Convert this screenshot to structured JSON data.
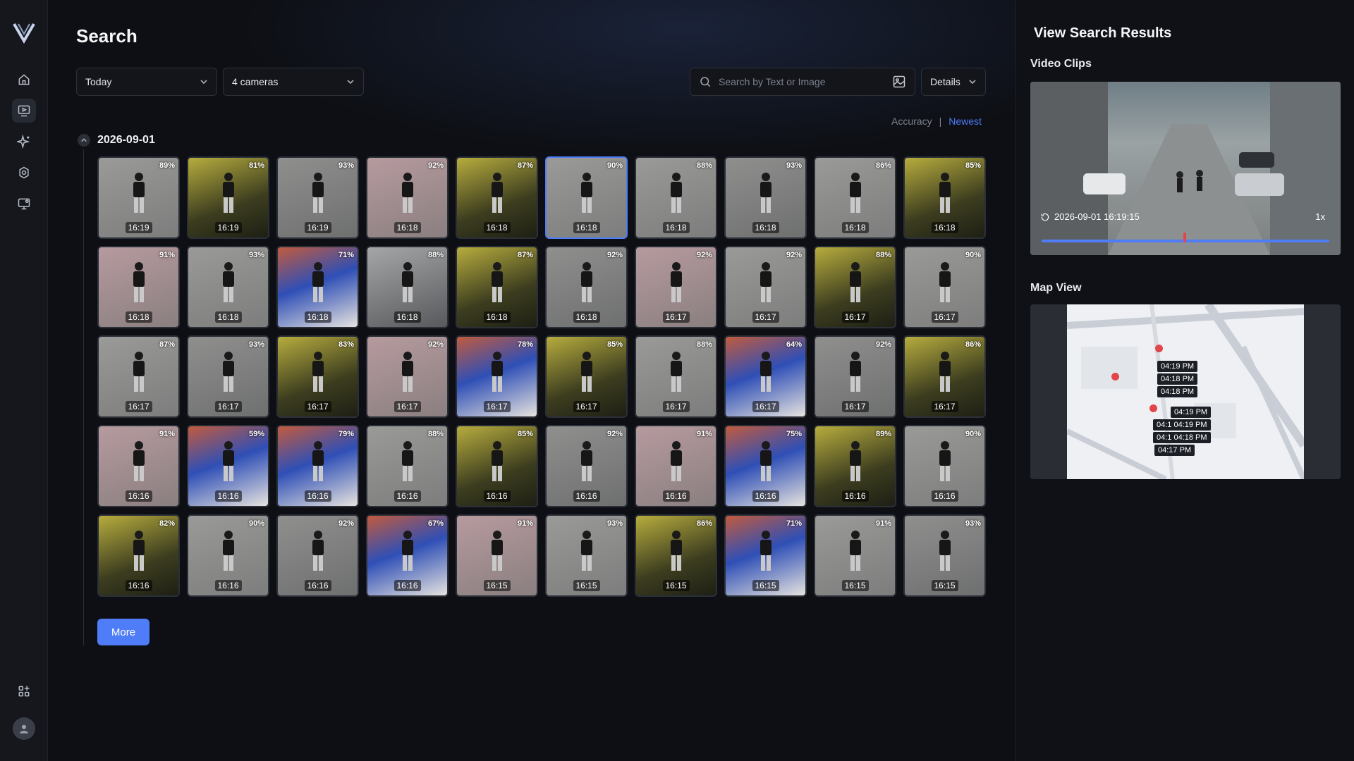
{
  "app": {
    "logo": "V"
  },
  "sidebar": {
    "items": [
      {
        "icon": "home-icon"
      },
      {
        "icon": "video-search-icon",
        "active": true
      },
      {
        "icon": "sparkle-icon"
      },
      {
        "icon": "settings-icon"
      },
      {
        "icon": "monitor-icon"
      },
      {
        "icon": "apps-icon"
      }
    ]
  },
  "header": {
    "title": "Search",
    "date_filter": "Today",
    "camera_filter": "4 cameras",
    "search_placeholder": "Search by Text or Image",
    "details_label": "Details"
  },
  "sort": {
    "accuracy": "Accuracy",
    "separator": "|",
    "newest": "Newest"
  },
  "results": {
    "date": "2026-09-01",
    "more_label": "More",
    "items": [
      {
        "pct": "89%",
        "time": "16:19",
        "scene": "street"
      },
      {
        "pct": "81%",
        "time": "16:19",
        "scene": "yellow"
      },
      {
        "pct": "93%",
        "time": "16:19",
        "scene": "road"
      },
      {
        "pct": "92%",
        "time": "16:18",
        "scene": "pink"
      },
      {
        "pct": "87%",
        "time": "16:18",
        "scene": "yellow"
      },
      {
        "pct": "90%",
        "time": "16:18",
        "scene": "street",
        "selected": true
      },
      {
        "pct": "88%",
        "time": "16:18",
        "scene": "street"
      },
      {
        "pct": "93%",
        "time": "16:18",
        "scene": "road"
      },
      {
        "pct": "86%",
        "time": "16:18",
        "scene": "street"
      },
      {
        "pct": "85%",
        "time": "16:18",
        "scene": "yellow"
      },
      {
        "pct": "91%",
        "time": "16:18",
        "scene": "pink"
      },
      {
        "pct": "93%",
        "time": "16:18",
        "scene": "street"
      },
      {
        "pct": "71%",
        "time": "16:18",
        "scene": "blue"
      },
      {
        "pct": "88%",
        "time": "16:18",
        "scene": "car"
      },
      {
        "pct": "87%",
        "time": "16:18",
        "scene": "yellow"
      },
      {
        "pct": "92%",
        "time": "16:18",
        "scene": "road"
      },
      {
        "pct": "92%",
        "time": "16:17",
        "scene": "pink"
      },
      {
        "pct": "92%",
        "time": "16:17",
        "scene": "street"
      },
      {
        "pct": "88%",
        "time": "16:17",
        "scene": "yellow"
      },
      {
        "pct": "90%",
        "time": "16:17",
        "scene": "street"
      },
      {
        "pct": "87%",
        "time": "16:17",
        "scene": "street"
      },
      {
        "pct": "93%",
        "time": "16:17",
        "scene": "road"
      },
      {
        "pct": "83%",
        "time": "16:17",
        "scene": "yellow"
      },
      {
        "pct": "92%",
        "time": "16:17",
        "scene": "pink"
      },
      {
        "pct": "78%",
        "time": "16:17",
        "scene": "blue"
      },
      {
        "pct": "85%",
        "time": "16:17",
        "scene": "yellow"
      },
      {
        "pct": "88%",
        "time": "16:17",
        "scene": "street"
      },
      {
        "pct": "64%",
        "time": "16:17",
        "scene": "blue"
      },
      {
        "pct": "92%",
        "time": "16:17",
        "scene": "road"
      },
      {
        "pct": "86%",
        "time": "16:17",
        "scene": "yellow"
      },
      {
        "pct": "91%",
        "time": "16:16",
        "scene": "pink"
      },
      {
        "pct": "59%",
        "time": "16:16",
        "scene": "blue"
      },
      {
        "pct": "79%",
        "time": "16:16",
        "scene": "blue"
      },
      {
        "pct": "88%",
        "time": "16:16",
        "scene": "street"
      },
      {
        "pct": "85%",
        "time": "16:16",
        "scene": "yellow"
      },
      {
        "pct": "92%",
        "time": "16:16",
        "scene": "road"
      },
      {
        "pct": "91%",
        "time": "16:16",
        "scene": "pink"
      },
      {
        "pct": "75%",
        "time": "16:16",
        "scene": "blue"
      },
      {
        "pct": "89%",
        "time": "16:16",
        "scene": "yellow"
      },
      {
        "pct": "90%",
        "time": "16:16",
        "scene": "street"
      },
      {
        "pct": "82%",
        "time": "16:16",
        "scene": "yellow"
      },
      {
        "pct": "90%",
        "time": "16:16",
        "scene": "street"
      },
      {
        "pct": "92%",
        "time": "16:16",
        "scene": "road"
      },
      {
        "pct": "67%",
        "time": "16:16",
        "scene": "blue"
      },
      {
        "pct": "91%",
        "time": "16:15",
        "scene": "pink"
      },
      {
        "pct": "93%",
        "time": "16:15",
        "scene": "street"
      },
      {
        "pct": "86%",
        "time": "16:15",
        "scene": "yellow"
      },
      {
        "pct": "71%",
        "time": "16:15",
        "scene": "blue"
      },
      {
        "pct": "91%",
        "time": "16:15",
        "scene": "street"
      },
      {
        "pct": "93%",
        "time": "16:15",
        "scene": "road"
      }
    ]
  },
  "right_panel": {
    "title": "View Search Results",
    "video_section": "Video Clips",
    "video_timestamp": "2026-09-01 16:19:15",
    "video_speed": "1x",
    "map_section": "Map View",
    "map_labels": [
      "04:19 PM",
      "04:18 PM",
      "04:18 PM",
      "04:19 PM",
      "04:1 04:19 PM",
      "04:1 04:18 PM",
      "04:17 PM"
    ]
  },
  "colors": {
    "accent": "#4f7cf7",
    "background": "#0d0f14",
    "pin": "#e0464a"
  }
}
